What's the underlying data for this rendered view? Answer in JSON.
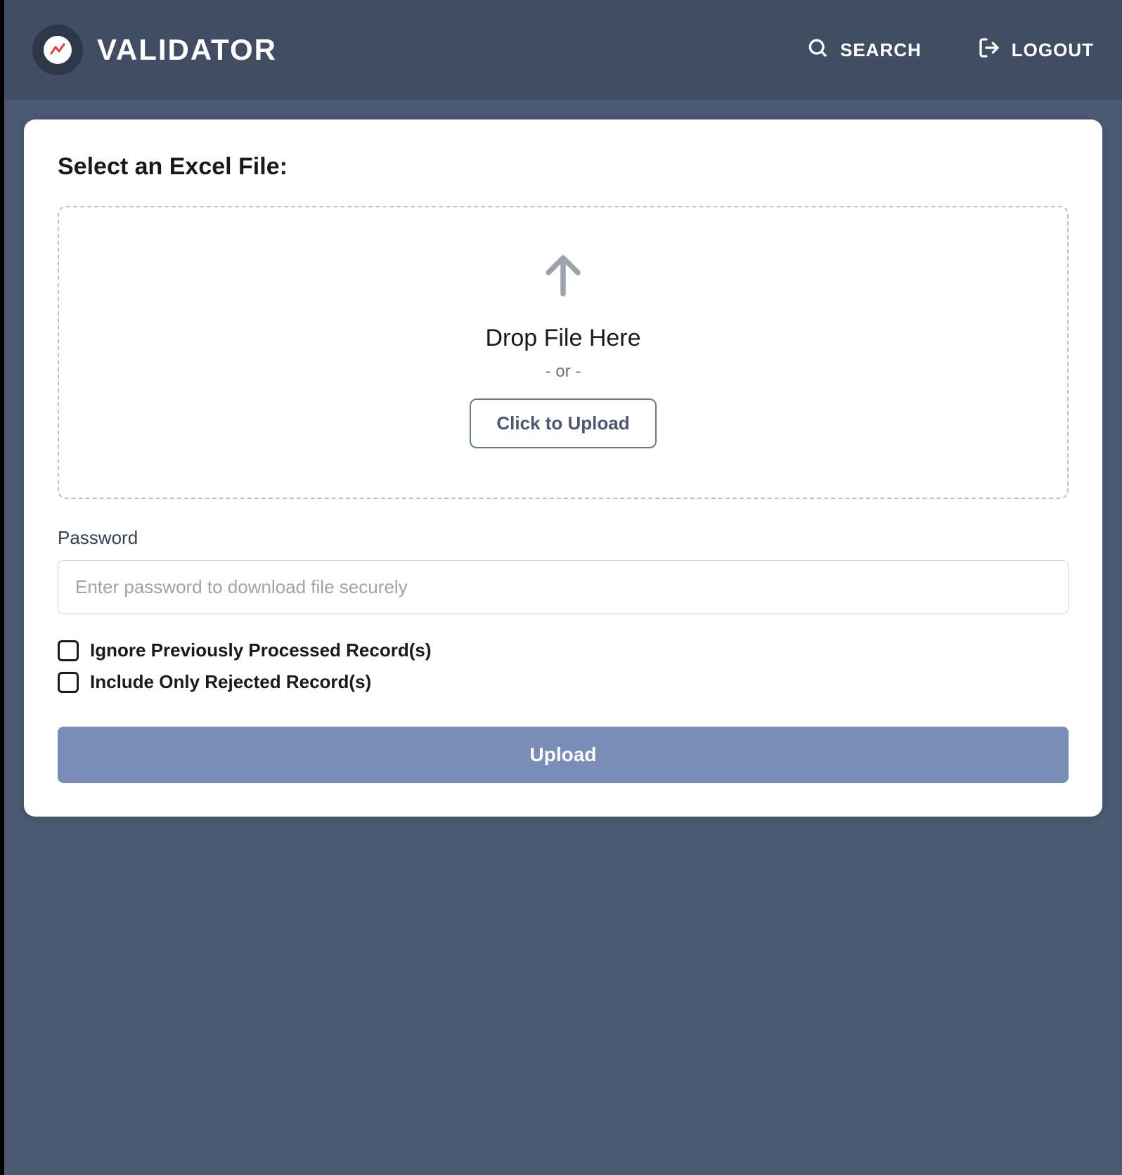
{
  "header": {
    "logo_text": "VALIDATOR",
    "search_label": "SEARCH",
    "logout_label": "LOGOUT"
  },
  "main": {
    "title": "Select an Excel File:",
    "dropzone": {
      "title": "Drop File Here",
      "or_text": "- or -",
      "button_label": "Click to Upload"
    },
    "password": {
      "label": "Password",
      "placeholder": "Enter password to download file securely"
    },
    "checkboxes": {
      "ignore_processed": "Ignore Previously Processed Record(s)",
      "only_rejected": "Include Only Rejected Record(s)"
    },
    "submit_label": "Upload"
  }
}
